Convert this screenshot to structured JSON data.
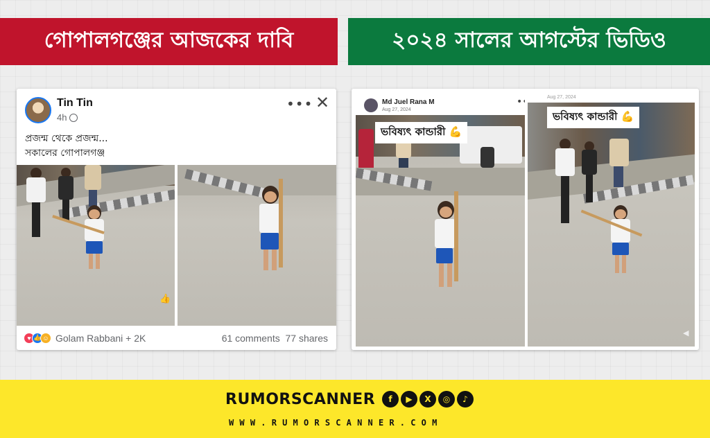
{
  "banners": {
    "left": "গোপালগঞ্জের আজকের দাবি",
    "right": "২০২৪ সালের আগস্টের ভিডিও"
  },
  "left_post": {
    "author": "Tin Tin",
    "time": "4h",
    "text_line1": "প্রজন্ম থেকে প্রজন্ম...",
    "text_line2": "সকালের গোপালগঞ্জ",
    "reactions_names": "Golam Rabbani + 2K",
    "comments": "61 comments",
    "shares": "77 shares",
    "icons": [
      "more-icon",
      "close-icon",
      "globe-icon",
      "love-reaction-icon",
      "like-reaction-icon",
      "haha-reaction-icon"
    ]
  },
  "right_post": {
    "author": "Md Juel Rana M",
    "date": "Aug 27, 2024",
    "date_second": "Aug 27, 2024",
    "caption": "ভবিষ্যৎ কান্ডারী",
    "caption_emoji": "💪"
  },
  "footer": {
    "brand": "RUMORSCANNER",
    "website": "WWW.RUMORSCANNER.COM",
    "socials": [
      {
        "name": "facebook-icon",
        "glyph": "f"
      },
      {
        "name": "youtube-icon",
        "glyph": "▶"
      },
      {
        "name": "x-icon",
        "glyph": "X"
      },
      {
        "name": "instagram-icon",
        "glyph": "◎"
      },
      {
        "name": "tiktok-icon",
        "glyph": "♪"
      }
    ]
  },
  "colors": {
    "left_banner": "#c0142c",
    "right_banner": "#0b7a3e",
    "footer_bg": "#fde72a",
    "facebook_blue": "#1877f2"
  }
}
